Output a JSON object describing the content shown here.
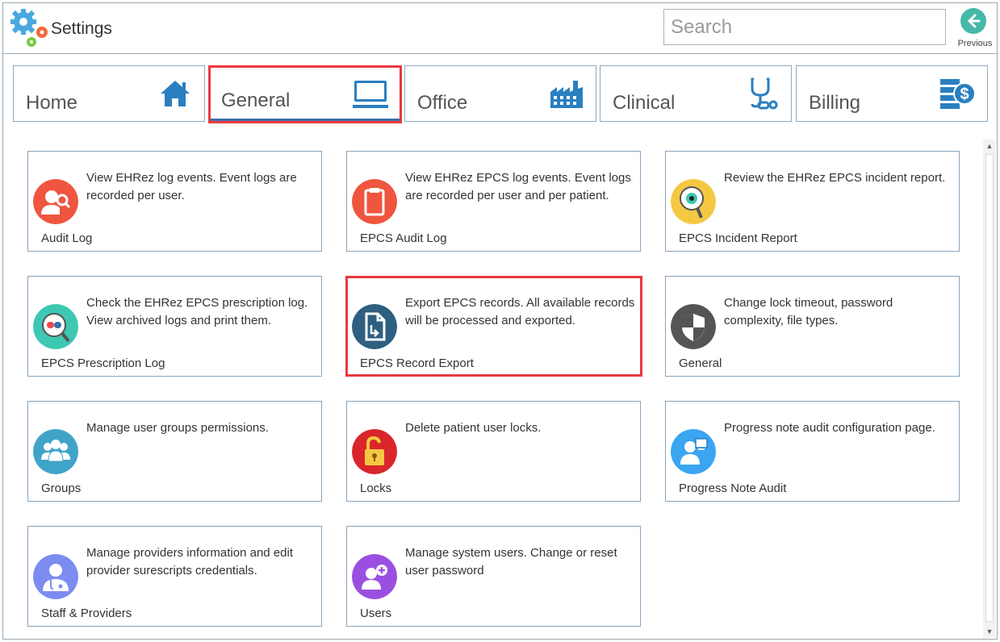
{
  "app": {
    "title": "Settings"
  },
  "search": {
    "placeholder": "Search",
    "value": ""
  },
  "previous": {
    "label": "Previous"
  },
  "tabs": [
    {
      "label": "Home",
      "icon": "home-icon",
      "active": false
    },
    {
      "label": "General",
      "icon": "monitor-icon",
      "active": true
    },
    {
      "label": "Office",
      "icon": "factory-icon",
      "active": false
    },
    {
      "label": "Clinical",
      "icon": "stethoscope-icon",
      "active": false
    },
    {
      "label": "Billing",
      "icon": "billing-icon",
      "active": false
    }
  ],
  "cards": [
    {
      "title": "Audit Log",
      "description": "View EHRez log events. Event logs are recorded per user.",
      "icon": "audit-log-icon",
      "color": "#f0553f"
    },
    {
      "title": "EPCS Audit Log",
      "description": "View EHRez EPCS log events. Event logs are recorded per user and per patient.",
      "icon": "clipboard-icon",
      "color": "#f0553f"
    },
    {
      "title": "EPCS Incident Report",
      "description": "Review the EHRez EPCS incident report.",
      "icon": "magnifier-eye-icon",
      "color": "#f5c842"
    },
    {
      "title": "EPCS Prescription Log",
      "description": "Check the EHRez EPCS prescription log. View archived logs and print them.",
      "icon": "prescription-magnifier-icon",
      "color": "#3ec7b3"
    },
    {
      "title": "EPCS Record Export",
      "description": "Export EPCS records. All available records will be processed and exported.",
      "icon": "export-document-icon",
      "color": "#2f5f80"
    },
    {
      "title": "General",
      "description": "Change lock timeout, password complexity, file types.",
      "icon": "shield-icon",
      "color": "#555555"
    },
    {
      "title": "Groups",
      "description": "Manage user groups permissions.",
      "icon": "group-icon",
      "color": "#3fa4c8"
    },
    {
      "title": "Locks",
      "description": "Delete patient user locks.",
      "icon": "padlock-icon",
      "color": "#d9262b"
    },
    {
      "title": "Progress Note Audit",
      "description": "Progress note audit configuration page.",
      "icon": "progress-note-icon",
      "color": "#3aa5f0"
    },
    {
      "title": "Staff & Providers",
      "description": "Manage providers information and edit provider surescripts credentials.",
      "icon": "doctor-icon",
      "color": "#7c8cf0"
    },
    {
      "title": "Users",
      "description": "Manage system users. Change or reset user password",
      "icon": "add-user-icon",
      "color": "#9b4fe0"
    }
  ],
  "colors": {
    "tab_active_underline": "#3a6fa8",
    "highlight": "#e8393f",
    "icon_blue": "#2a7fc1",
    "accent_teal": "#45b8a8"
  }
}
